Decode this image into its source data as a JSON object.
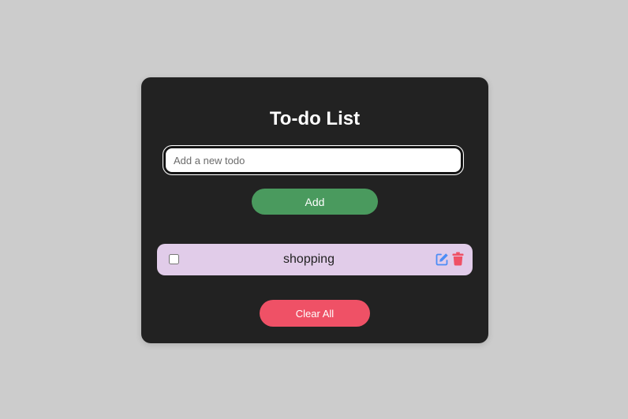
{
  "app": {
    "title": "To-do List"
  },
  "input": {
    "placeholder": "Add a new todo",
    "value": ""
  },
  "add_button": {
    "label": "Add"
  },
  "todos": [
    {
      "text": "shopping",
      "completed": false
    }
  ],
  "clear_button": {
    "label": "Clear All"
  },
  "icons": {
    "edit": "edit-icon",
    "delete": "trash-icon"
  },
  "colors": {
    "background": "#cccccc",
    "card": "#222222",
    "add_button": "#4a9a5e",
    "clear_button": "#ef5166",
    "todo_item": "#e1cce9",
    "edit_icon": "#4c8df6",
    "delete_icon": "#ef5166"
  }
}
